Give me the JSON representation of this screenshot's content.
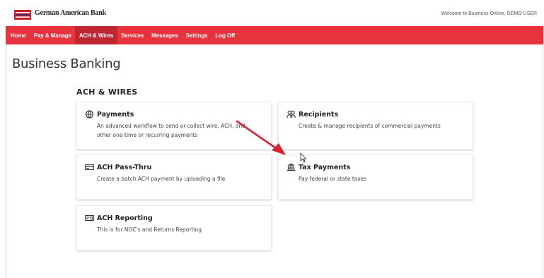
{
  "brand": {
    "name": "German American Bank",
    "welcome": "Welcome to Business Online, DEMO USER",
    "colors": {
      "nav_red": "#e8323c",
      "nav_active": "#be2731",
      "arrow_red": "#d9202e"
    }
  },
  "nav": {
    "items": [
      {
        "label": "Home",
        "active": false
      },
      {
        "label": "Pay & Manage",
        "active": false
      },
      {
        "label": "ACH & Wires",
        "active": true
      },
      {
        "label": "Services",
        "active": false
      },
      {
        "label": "Messages",
        "active": false
      },
      {
        "label": "Settings",
        "active": false
      },
      {
        "label": "Log Off",
        "active": false
      }
    ]
  },
  "page": {
    "title": "Business Banking",
    "section_title": "ACH & WIRES"
  },
  "cards": {
    "payments": {
      "title": "Payments",
      "desc_line1": "An advanced workflow to send or collect wire, ACH, and",
      "desc_line2": "other one-time or recurring payments",
      "icon": "globe-money-icon"
    },
    "recipients": {
      "title": "Recipients",
      "desc_line1": "Create & manage recipients of commercial payments",
      "icon": "people-icon"
    },
    "ach_pass_thru": {
      "title": "ACH Pass-Thru",
      "desc_line1": "Create a batch ACH payment by uploading a file",
      "icon": "card-upload-icon"
    },
    "tax_payments": {
      "title": "Tax Payments",
      "desc_line1": "Pay federal or state taxes",
      "icon": "government-building-icon"
    },
    "ach_reporting": {
      "title": "ACH Reporting",
      "desc_line1": "This is for NOC's and Returns Reporting",
      "icon": "card-report-icon"
    }
  }
}
